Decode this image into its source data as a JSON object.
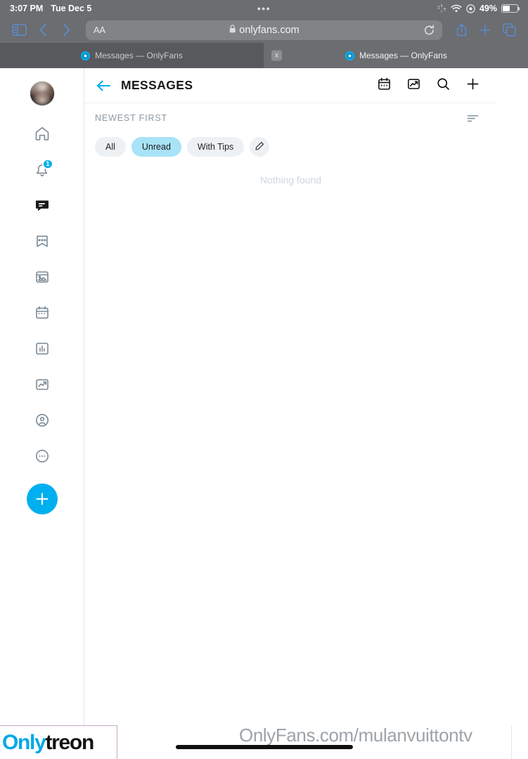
{
  "statusbar": {
    "time": "3:07 PM",
    "date": "Tue Dec 5",
    "battery_percent": "49%",
    "battery_level": 49,
    "icons": [
      "airplay-icon",
      "wifi-icon",
      "do-not-disturb-icon",
      "battery-icon"
    ],
    "center_dots": "•••"
  },
  "browser": {
    "nav": {
      "sidebar_toggle": "sidebar-toggle-icon",
      "back": "back-chevron-icon",
      "forward": "forward-chevron-icon"
    },
    "address_bar": {
      "text_size_label": "AA",
      "url": "onlyfans.com",
      "lock": "lock-icon",
      "reload": "reload-icon"
    },
    "actions": {
      "share": "share-icon",
      "new_tab": "plus-icon",
      "tabs": "tabs-overview-icon"
    },
    "tabs": [
      {
        "title": "Messages — OnlyFans",
        "active": false
      },
      {
        "title": "Messages — OnlyFans",
        "active": true,
        "close_label": "x"
      }
    ]
  },
  "sidebar": {
    "avatar_alt": "user-avatar",
    "items": [
      {
        "name": "home",
        "icon": "home-icon",
        "active": false,
        "badge": ""
      },
      {
        "name": "notifications",
        "icon": "bell-icon",
        "active": false,
        "badge": "1"
      },
      {
        "name": "messages",
        "icon": "chat-bubble-icon",
        "active": true,
        "badge": ""
      },
      {
        "name": "collections",
        "icon": "bookmark-star-icon",
        "active": false,
        "badge": ""
      },
      {
        "name": "vault",
        "icon": "vault-image-icon",
        "active": false,
        "badge": ""
      },
      {
        "name": "queue",
        "icon": "calendar-icon",
        "active": false,
        "badge": ""
      },
      {
        "name": "statistics",
        "icon": "bar-chart-icon",
        "active": false,
        "badge": ""
      },
      {
        "name": "statements",
        "icon": "trending-chart-icon",
        "active": false,
        "badge": ""
      },
      {
        "name": "profile",
        "icon": "user-circle-icon",
        "active": false,
        "badge": ""
      },
      {
        "name": "more",
        "icon": "ellipsis-circle-icon",
        "active": false,
        "badge": ""
      }
    ],
    "new_post_label": "+"
  },
  "main": {
    "back_icon": "back-arrow-icon",
    "title": "MESSAGES",
    "header_actions": [
      {
        "name": "queue",
        "icon": "calendar-icon"
      },
      {
        "name": "statistics",
        "icon": "trending-chart-icon"
      },
      {
        "name": "search",
        "icon": "search-icon"
      },
      {
        "name": "new-message",
        "icon": "plus-icon"
      }
    ],
    "sort": {
      "label": "NEWEST FIRST",
      "icon": "sort-icon"
    },
    "filters": [
      {
        "label": "All",
        "selected": false
      },
      {
        "label": "Unread",
        "selected": true
      },
      {
        "label": "With Tips",
        "selected": false
      }
    ],
    "edit_filter_icon": "pencil-icon",
    "empty_state": "Nothing found"
  },
  "watermark": {
    "logo_primary": "Only",
    "logo_secondary": "treon",
    "url": "OnlyFans.com/mulanvuittontv"
  },
  "colors": {
    "accent": "#00aff0",
    "chip_selected_bg": "#a9e3f7",
    "chip_bg": "#eef1f4",
    "chrome_bg": "#6b6d70",
    "tab_inactive_bg": "#58595c",
    "empty_text": "#cfd6db",
    "muted_text": "#8a9aa6",
    "logo_blue": "#00a8e8"
  }
}
